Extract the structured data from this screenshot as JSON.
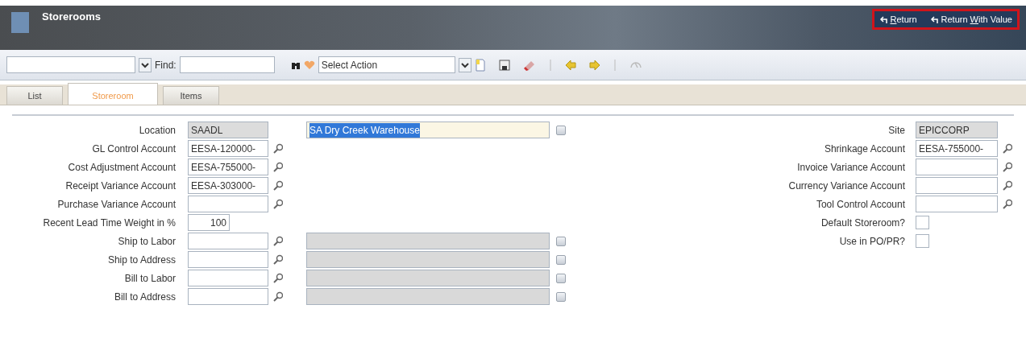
{
  "header": {
    "title": "Storerooms",
    "links": [
      {
        "hotkey": "R",
        "rest": "eturn"
      },
      {
        "text": "Return ",
        "hotkey": "W",
        "rest": "ith Value"
      }
    ]
  },
  "toolbar": {
    "find_label": "Find:",
    "action_select": "Select Action"
  },
  "tabs": [
    {
      "label": "List",
      "selected": false
    },
    {
      "label": "Storeroom",
      "selected": true
    },
    {
      "label": "Items",
      "selected": false
    }
  ],
  "left_fields": [
    {
      "label": "Location",
      "value": "SAADL",
      "kind": "readonly",
      "description": {
        "value": "SA Dry Creek Warehouse",
        "readonly": false,
        "highlighted": true
      }
    },
    {
      "label": "GL Control Account",
      "value": "EESA-120000-",
      "kind": "lookup"
    },
    {
      "label": "Cost Adjustment Account",
      "value": "EESA-755000-",
      "kind": "lookup"
    },
    {
      "label": "Receipt Variance Account",
      "value": "EESA-303000-",
      "kind": "lookup"
    },
    {
      "label": "Purchase Variance Account",
      "kind": "lookup"
    },
    {
      "label": "Recent Lead Time Weight in %",
      "value": "100",
      "kind": "number"
    },
    {
      "label": "Ship to Labor",
      "kind": "lookup",
      "description": {
        "readonly": true
      }
    },
    {
      "label": "Ship to Address",
      "kind": "lookup",
      "description": {
        "readonly": true
      }
    },
    {
      "label": "Bill to Labor",
      "kind": "lookup",
      "description": {
        "readonly": true
      }
    },
    {
      "label": "Bill to Address",
      "kind": "lookup",
      "description": {
        "readonly": true
      }
    }
  ],
  "right_fields": [
    {
      "label": "Site",
      "value": "EPICCORP",
      "kind": "readonly"
    },
    {
      "label": "Shrinkage Account",
      "value": "EESA-755000-",
      "kind": "lookup"
    },
    {
      "label": "Invoice Variance Account",
      "kind": "lookup"
    },
    {
      "label": "Currency Variance Account",
      "kind": "lookup"
    },
    {
      "label": "Tool Control Account",
      "kind": "lookup"
    },
    {
      "label": "Default Storeroom?",
      "kind": "checkbox",
      "checked": false
    },
    {
      "label": "Use in PO/PR?",
      "kind": "checkbox",
      "checked": false
    }
  ]
}
